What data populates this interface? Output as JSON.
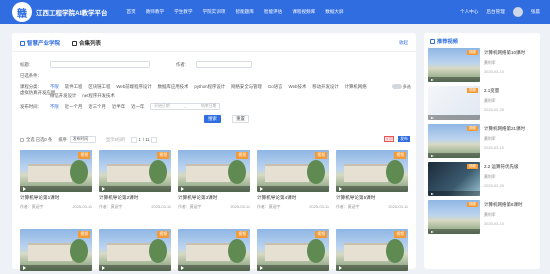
{
  "header": {
    "logo_text": "赣",
    "title": "江西工程学院AI教学平台",
    "nav": [
      "首页",
      "教师教学",
      "学生教学",
      "学院实训项",
      "智能题库",
      "智能评估",
      "课程视频库",
      "数据大屏"
    ],
    "personal_center": "个人中心",
    "admin": "后台管理",
    "username": "张晨"
  },
  "tabs": {
    "smart_industry": "智慧产业学院",
    "cooperation": "合集列表",
    "collapse": "收起"
  },
  "filters": {
    "title_label": "标题:",
    "author_label": "作者:",
    "selected_label": "已选条件:",
    "category_label": "课程分类:",
    "category_options": [
      "不限",
      "软件工程",
      "区块链工程",
      "Web前端程序设计",
      "数据库应用技术",
      "python程序设计",
      "网络安全与管理",
      "Go语言",
      "Web技术",
      "移动开发设计",
      "计算机网络",
      "虚拟仿真开发应用",
      "微信开发设计",
      "net程序开发技术"
    ],
    "multi_label": "多选",
    "time_label": "发布时间:",
    "time_options": [
      "不限",
      "近一个月",
      "近三个月",
      "近半年",
      "近一年"
    ],
    "date_start": "开始日期",
    "date_end": "结束日期",
    "search_button": "搜索",
    "reset_button": "重置"
  },
  "list_bar": {
    "select_all": "全选 已选0 条",
    "sort": "排序",
    "sort_value": "发布时间",
    "view_label": "显示5份的",
    "page": "1",
    "total": "/ 11",
    "tag_red": "全部",
    "tag_blue": "发布"
  },
  "cards": [
    {
      "badge": "视频",
      "title": "计算机导论第1课时",
      "author": "作者：黄涵宇",
      "date": "2025-03-11"
    },
    {
      "badge": "视频",
      "title": "计算机导论第2课时",
      "author": "作者：黄涵宇",
      "date": "2025-03-11"
    },
    {
      "badge": "视频",
      "title": "计算机导论第3课时",
      "author": "作者：黄涵宇",
      "date": "2025-03-11"
    },
    {
      "badge": "视频",
      "title": "计算机导论第4课时",
      "author": "作者：黄涵宇",
      "date": "2025-03-11"
    },
    {
      "badge": "视频",
      "title": "计算机导论第5课时",
      "author": "作者：黄涵宇",
      "date": "2025-03-11"
    },
    {
      "badge": "视频",
      "title": "",
      "author": "",
      "date": ""
    },
    {
      "badge": "视频",
      "title": "",
      "author": "",
      "date": ""
    },
    {
      "badge": "视频",
      "title": "",
      "author": "",
      "date": ""
    },
    {
      "badge": "视频",
      "title": "",
      "author": "",
      "date": ""
    },
    {
      "badge": "视频",
      "title": "",
      "author": "",
      "date": ""
    }
  ],
  "sidebar": {
    "title": "推荐视频",
    "items": [
      {
        "badge": "视频",
        "title": "计算机网络第10课时",
        "author": "黄利军",
        "date": "2025-03-10",
        "style": "campus"
      },
      {
        "badge": "视频",
        "title": "2.1变量",
        "author": "黄利军",
        "date": "2025-02-25",
        "style": "white"
      },
      {
        "badge": "视频",
        "title": "计算机网络第21课时",
        "author": "黄利军",
        "date": "2025-03-10",
        "style": "campus"
      },
      {
        "badge": "视频",
        "title": "2.2 运算符优先级",
        "author": "黄利军",
        "date": "2025-02-25",
        "style": "dark"
      },
      {
        "badge": "视频",
        "title": "计算机网络第6课时",
        "author": "黄利军",
        "date": "2025-03-10",
        "style": "campus"
      }
    ]
  }
}
